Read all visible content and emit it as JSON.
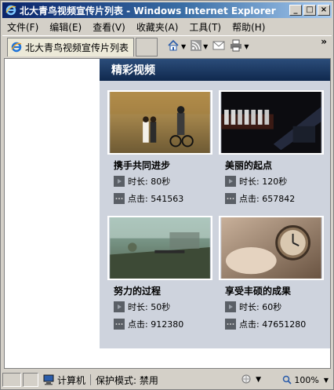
{
  "window": {
    "title": "北大青鸟视频宣传片列表 - Windows Internet Explorer",
    "controls": [
      "_",
      "□",
      "×"
    ]
  },
  "menu": [
    "文件(F)",
    "编辑(E)",
    "查看(V)",
    "收藏夹(A)",
    "工具(T)",
    "帮助(H)"
  ],
  "tab": {
    "label": "北大青鸟视频宣传片列表"
  },
  "toolbar": {
    "more": "»"
  },
  "panel": {
    "header": "精彩视频"
  },
  "videos": [
    {
      "title": "携手共同进步",
      "duration": "时长: 80秒",
      "clicks": "点击: 541563"
    },
    {
      "title": "美丽的起点",
      "duration": "时长: 120秒",
      "clicks": "点击: 657842"
    },
    {
      "title": "努力的过程",
      "duration": "时长: 50秒",
      "clicks": "点击: 912380"
    },
    {
      "title": "享受丰硕的成果",
      "duration": "时长: 60秒",
      "clicks": "点击: 47651280"
    }
  ],
  "status": {
    "zone": "计算机",
    "protected_mode": "保护模式: 禁用",
    "zoom": "100%"
  },
  "colors": {
    "panel_bg": "#ced3dd",
    "header_bg": "#10294e",
    "title_bar": "#0a246a"
  }
}
